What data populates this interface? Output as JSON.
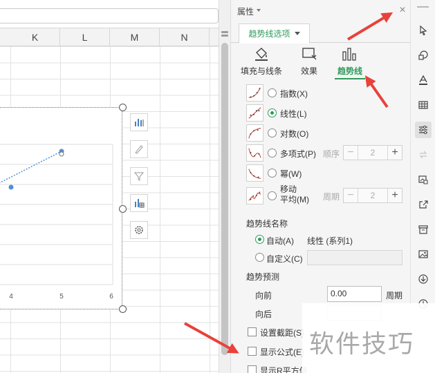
{
  "sheet": {
    "columns": [
      "K",
      "L",
      "M",
      "N"
    ],
    "chart": {
      "x_tick_labels": [
        "4",
        "5",
        "6"
      ],
      "points": [
        [
          3.6,
          2.7
        ],
        [
          5.0,
          3.5
        ]
      ]
    },
    "chart_tools": [
      "chart-elements-icon",
      "chart-style-icon",
      "chart-filter-icon",
      "chart-layout-icon",
      "chart-settings-icon"
    ]
  },
  "pane": {
    "title": "属性",
    "close_label": "×",
    "tab_label": "趋势线选项",
    "sub_tabs": [
      {
        "label": "填充与线条",
        "icon": "fill-bucket-icon"
      },
      {
        "label": "效果",
        "icon": "effects-icon"
      },
      {
        "label": "趋势线",
        "icon": "trendline-chart-icon",
        "active": true
      }
    ],
    "types": {
      "exponential": "指数(X)",
      "linear": "线性(L)",
      "logarithmic": "对数(O)",
      "polynomial": "多项式(P)",
      "power": "幂(W)",
      "moving_average_line1": "移动",
      "moving_average_line2": "平均(M)",
      "selected": "linear"
    },
    "order_label": "顺序",
    "order_value": "2",
    "period_label": "周期",
    "period_value": "2",
    "minus": "−",
    "plus": "+",
    "trend_name": {
      "title": "趋势线名称",
      "auto_label": "自动(A)",
      "auto_value": "线性 (系列1)",
      "custom_label": "自定义(C)",
      "custom_value": ""
    },
    "forecast": {
      "title": "趋势预测",
      "forward_label": "向前",
      "forward_value": "0.00",
      "forward_unit": "周期",
      "backward_label": "向后",
      "backward_value": ""
    },
    "checks": {
      "set_intercept": "设置截距(S)",
      "show_equation": "显示公式(E)",
      "show_r_squared": "显示R平方值"
    }
  },
  "toolbar_icons": [
    "cursor-icon",
    "shapes-icon",
    "text-style-icon",
    "table-icon",
    "properties-icon",
    "flip-icon",
    "picture-crop-icon",
    "share-icon",
    "archive-icon",
    "image-icon",
    "download-icon",
    "history-icon"
  ],
  "watermark": "软件技巧",
  "colors": {
    "accent": "#2f9a5a",
    "annotation": "#e8423a",
    "series": "#4f90d8"
  }
}
